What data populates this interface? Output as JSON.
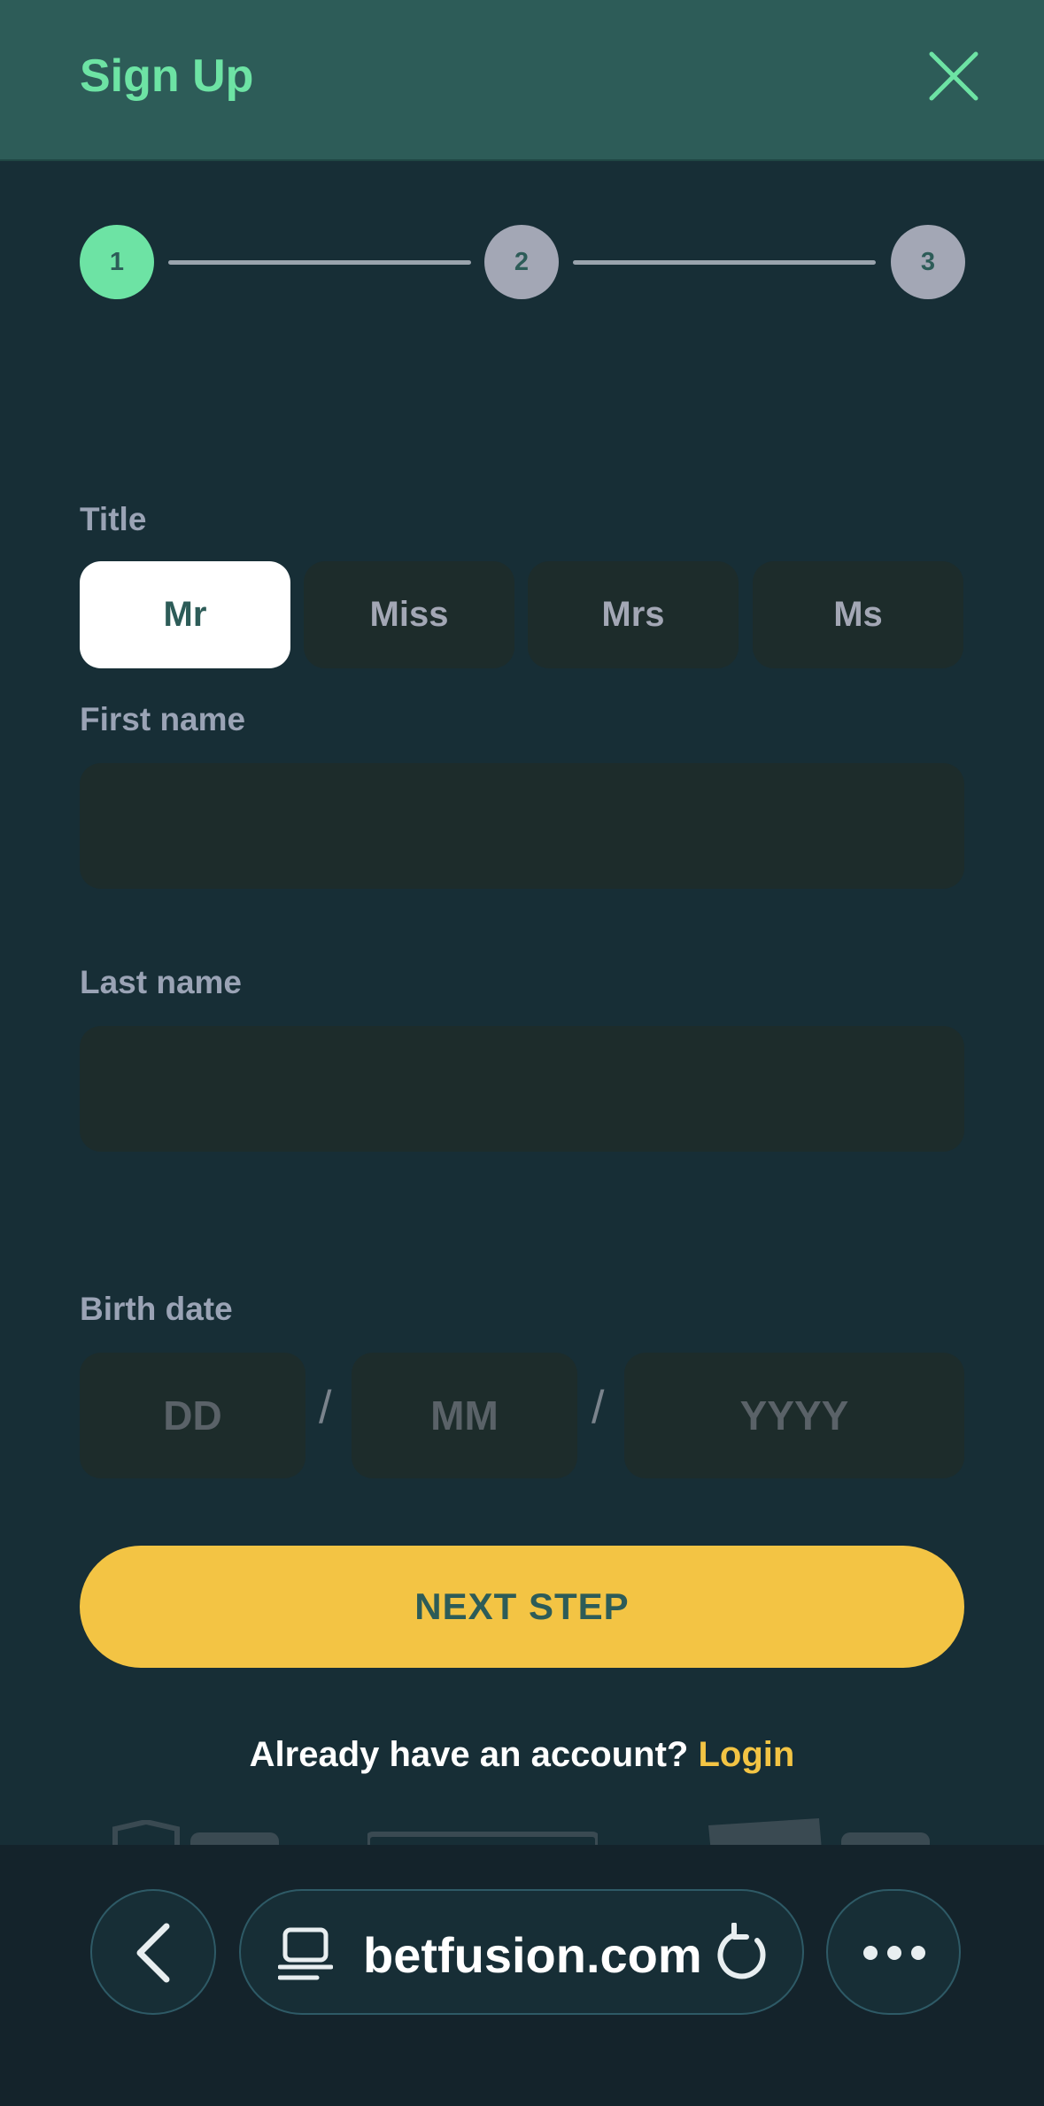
{
  "header": {
    "title": "Sign Up"
  },
  "stepper": {
    "steps": [
      "1",
      "2",
      "3"
    ],
    "current": 1
  },
  "form": {
    "title_label": "Title",
    "title_options": [
      "Mr",
      "Miss",
      "Mrs",
      "Ms"
    ],
    "title_selected": "Mr",
    "first_name_label": "First name",
    "first_name_value": "",
    "last_name_label": "Last name",
    "last_name_value": "",
    "birth_date_label": "Birth date",
    "day_placeholder": "DD",
    "month_placeholder": "MM",
    "year_placeholder": "YYYY",
    "date_separator": "/"
  },
  "actions": {
    "next_label": "NEXT STEP",
    "login_prompt": "Already have an account?",
    "login_link": "Login"
  },
  "browser": {
    "url": "betfusion.com"
  },
  "colors": {
    "header_bg": "#2d5c58",
    "page_bg": "#172e36",
    "accent_green": "#6de3a4",
    "accent_yellow": "#f3c444",
    "field_bg": "#1d2c2b"
  },
  "icons": [
    "close-icon",
    "back-chevron-icon",
    "reader-mode-icon",
    "reload-icon",
    "more-dots-icon"
  ]
}
